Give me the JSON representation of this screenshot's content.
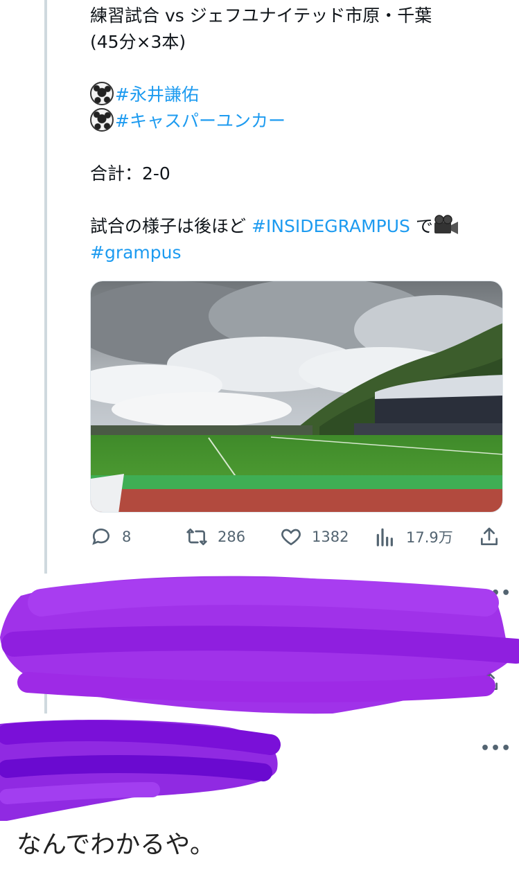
{
  "tweet": {
    "line1": "練習試合 vs ジェフユナイテッド市原・千葉",
    "line2": "(45分×3本)",
    "scorer1": "#永井謙佑",
    "scorer2": "#キャスパーユンカー",
    "total": "合計：2-0",
    "line_later_prefix": "試合の様子は後ほど ",
    "hashtag_inside": "#INSIDEGRAMPUS",
    "line_later_suffix": " で",
    "hashtag_grampus": "#grampus"
  },
  "photo": {
    "icon": "stadium-photo"
  },
  "actions": {
    "replies": "8",
    "retweets": "286",
    "likes": "1382",
    "views": "17.9万"
  },
  "reply_more": "•••",
  "reply2_more": "•••",
  "reply2_text": "なんでわかるや。",
  "colors": {
    "accent": "#1d9bf0",
    "muted": "#536471",
    "scribble": "#9b27e8"
  }
}
